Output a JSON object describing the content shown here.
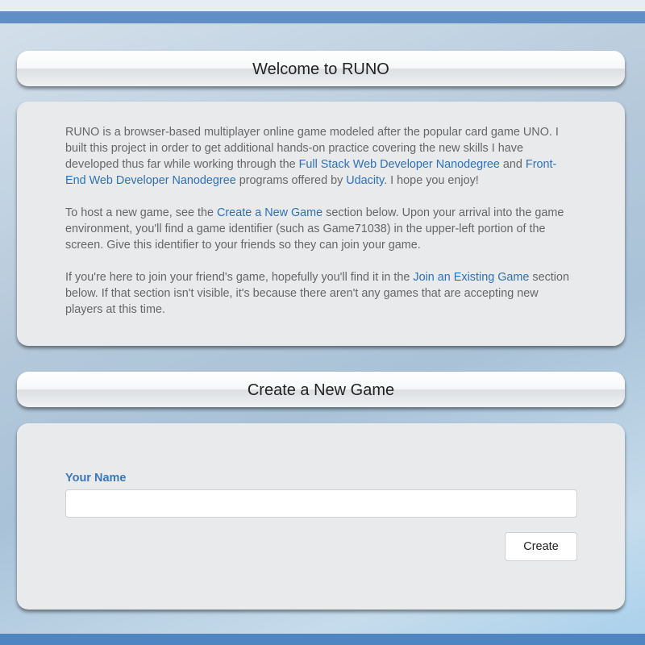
{
  "welcome": {
    "title": "Welcome to RUNO",
    "p1": {
      "t1": "RUNO is a browser-based multiplayer online game modeled after the popular card game UNO. I built this project in order to get additional hands-on practice covering the new skills I have developed thus far while working through the ",
      "link1": "Full Stack Web Developer Nanodegree",
      "t2": " and ",
      "link2": "Front-End Web Developer Nanodegree",
      "t3": " programs offered by ",
      "link3": "Udacity",
      "t4": ". I hope you enjoy!"
    },
    "p2": {
      "t1": "To host a new game, see the ",
      "link1": "Create a New Game",
      "t2": " section below. Upon your arrival into the game environment, you'll find a game identifier (such as Game71038) in the upper-left portion of the screen. Give this identifier to your friends so they can join your game."
    },
    "p3": {
      "t1": "If you're here to join your friend's game, hopefully you'll find it in the ",
      "link1": "Join an Existing Game",
      "t2": " section below. If that section isn't visible, it's because there aren't any games that are accepting new players at this time."
    }
  },
  "create": {
    "title": "Create a New Game",
    "name_label": "Your Name",
    "name_value": "",
    "create_label": "Create"
  },
  "colors": {
    "link": "#2e70b8",
    "label": "#3b78b9",
    "top_bar": "#5f8fc4",
    "bottom_bar": "#4f86c2"
  }
}
